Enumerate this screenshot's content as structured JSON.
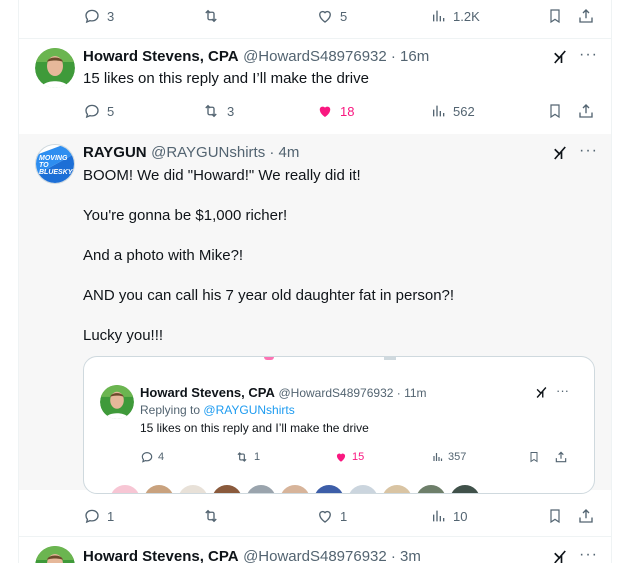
{
  "top_tweet": {
    "reply_count": "3",
    "like_count": "5",
    "view_count": "1.2K"
  },
  "tweet_howard": {
    "name": "Howard Stevens, CPA",
    "handle_time": "@HowardS48976932 · 16m",
    "text": "15 likes on this reply and I’ll make the drive",
    "reply_count": "5",
    "retweet_count": "3",
    "like_count": "18",
    "view_count": "562"
  },
  "tweet_raygun": {
    "name": "RAYGUN",
    "handle_time": "@RAYGUNshirts · 4m",
    "avatar_text": [
      "MOVING",
      "TO",
      "BLUESKY"
    ],
    "lines": [
      "BOOM! We did \"Howard!\" We really did it!",
      "You're gonna be $1,000 richer!",
      "And a photo with Mike?!",
      "AND you can call his 7 year old daughter fat in person?!",
      "Lucky you!!!"
    ],
    "reply_count": "1",
    "like_count": "1",
    "view_count": "10"
  },
  "quote": {
    "name": "Howard Stevens, CPA",
    "handle_time": "@HowardS48976932 · 11m",
    "replying_prefix": "Replying to",
    "replying_handle": "@RAYGUNshirts",
    "text": "15 likes on this reply and I’ll make the drive",
    "reply_count": "4",
    "retweet_count": "1",
    "like_count": "15",
    "view_count": "357"
  },
  "bottom_tweet": {
    "name": "Howard Stevens, CPA",
    "handle_time": "@HowardS48976932 · 3m"
  },
  "colors": {
    "like_pink": "#f91880",
    "link_blue": "#1d9bf0",
    "muted": "#536471"
  }
}
